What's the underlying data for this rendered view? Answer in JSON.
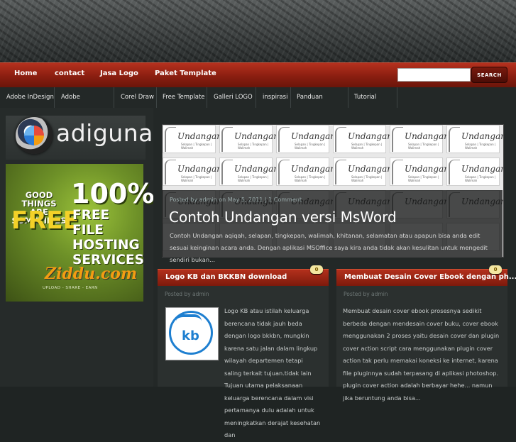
{
  "topnav": {
    "items": [
      "Home",
      "contact",
      "Jasa Logo",
      "Paket Template"
    ],
    "search_placeholder": "",
    "search_button": "SEARCH"
  },
  "catbar": {
    "items": [
      "Adobe InDesign",
      "Adobe Photoshop",
      "Corel Draw",
      "Free Template",
      "Galleri LOGO",
      "inspirasi",
      "Panduan Blogger",
      "Tutorial Desain"
    ]
  },
  "sidebar": {
    "logo_text": "adiguna",
    "ad": {
      "line1": "GOOD THINGS ARE SOMETIMES",
      "line2": "FREE",
      "big": "100%",
      "sub": "FREE FILE HOSTING SERVICES",
      "brand": "Ziddu.com",
      "tagline": "UPLOAD - SHARE - EARN"
    }
  },
  "feature": {
    "card_title": "Undangan",
    "card_sub": "Selapan | Tingkepan | Walimah",
    "meta": "Posted by admin on May 5, 2011 | 1 Comment",
    "title": "Contoh Undangan versi MsWord",
    "excerpt": "Contoh Undangan aqiqah, selapan, tingkepan, walimah, khitanan, selamatan atau apapun bisa anda edit sesuai keinginan acara anda. Dengan aplikasi MSOffice saya kira anda tidak akan kesulitan untuk mengedit sendiri bukan..."
  },
  "posts": [
    {
      "title": "Logo KB dan BKKBN download",
      "comments": "0",
      "byline": "Posted by admin",
      "image_label": "kb",
      "body": "Logo KB atau istilah keluarga berencana tidak jauh beda dengan logo bkkbn, mungkin karena satu jalan dalam lingkup wilayah departemen tetapi saling terkait tujuan.tidak lain Tujuan utama pelaksanaan keluarga berencana dalam visi pertamanya dulu adalah untuk meningkatkan derajat kesehatan dan"
    },
    {
      "title": "Membuat Desain Cover Ebook dengan ph...",
      "comments": "0",
      "byline": "Posted by admin",
      "body": "Membuat desain cover ebook prosesnya sedikit berbeda dengan mendesain cover buku, cover ebook menggunakan 2 proses yaitu desain cover dan plugin cover action script cara menggunakan plugin cover action tak perlu memakai koneksi ke internet, karena file pluginnya sudah terpasang di aplikasi photoshop. plugin cover action adalah berbayar hehe... namun jika beruntung anda bisa..."
    }
  ]
}
